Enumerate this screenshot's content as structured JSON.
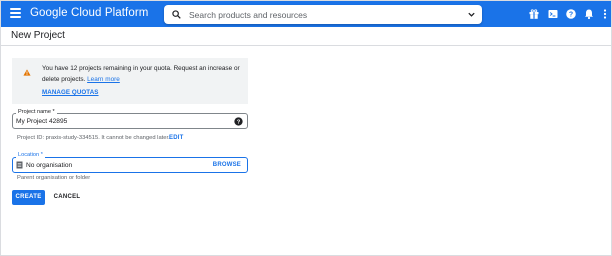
{
  "app": {
    "title": "Google Cloud Platform"
  },
  "search": {
    "placeholder": "Search products and resources"
  },
  "toolbar": {
    "icons": [
      "gift-icon",
      "cloud-shell-icon",
      "help-icon",
      "notifications-icon",
      "more-vert-icon"
    ]
  },
  "page": {
    "title": "New Project"
  },
  "quota_notice": {
    "text": "You have 12 projects remaining in your quota. Request an increase or delete projects.",
    "learn_more": "Learn more",
    "manage_quotas": "MANAGE QUOTAS"
  },
  "project_name": {
    "label": "Project name *",
    "value": "My Project 42895",
    "project_id_text": "Project ID: praxis-study-334515. It cannot be changed later.",
    "edit_label": "EDIT"
  },
  "location": {
    "label": "Location *",
    "value": "No organisation",
    "browse_label": "BROWSE",
    "hint": "Parent organisation or folder"
  },
  "actions": {
    "create": "CREATE",
    "cancel": "CANCEL"
  },
  "colors": {
    "accent": "#1a73e8",
    "warning": "#e37400",
    "notice_bg": "#f1f3f4"
  }
}
